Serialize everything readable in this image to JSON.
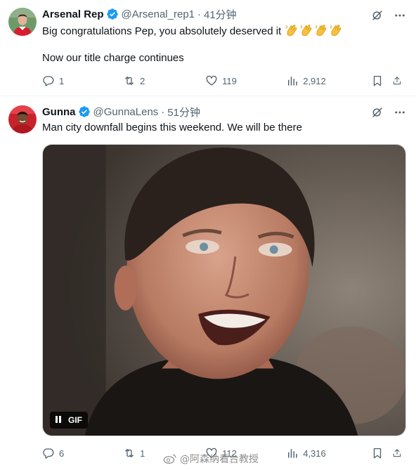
{
  "tweets": [
    {
      "author_name": "Arsenal Rep",
      "handle": "@Arsenal_rep1",
      "separator": "·",
      "time": "41分钟",
      "text_line1": "Big congratulations Pep, you absolutely deserved it",
      "text_line2": "Now our title charge continues",
      "reply_count": "1",
      "repost_count": "2",
      "like_count": "119",
      "view_count": "2,912",
      "avatar_icon": "player-avatar-red-kit",
      "emoji_icons": [
        "clapping-hands-icon",
        "clapping-hands-icon",
        "clapping-hands-icon",
        "clapping-hands-icon"
      ]
    },
    {
      "author_name": "Gunna",
      "handle": "@GunnaLens",
      "separator": "·",
      "time": "51分钟",
      "text_line1": "Man city downfall begins this weekend. We will be there",
      "media_badge": "GIF",
      "reply_count": "6",
      "repost_count": "1",
      "like_count": "112",
      "view_count": "4,316",
      "avatar_icon": "player-avatar-red-kit"
    }
  ],
  "watermark": {
    "text": "@阿森纳看台教授",
    "icon": "weibo-icon"
  },
  "colors": {
    "verified_blue": "#1d9bf0",
    "secondary_text": "#536471",
    "primary_text": "#0f1419",
    "divider": "#eff3f4"
  }
}
